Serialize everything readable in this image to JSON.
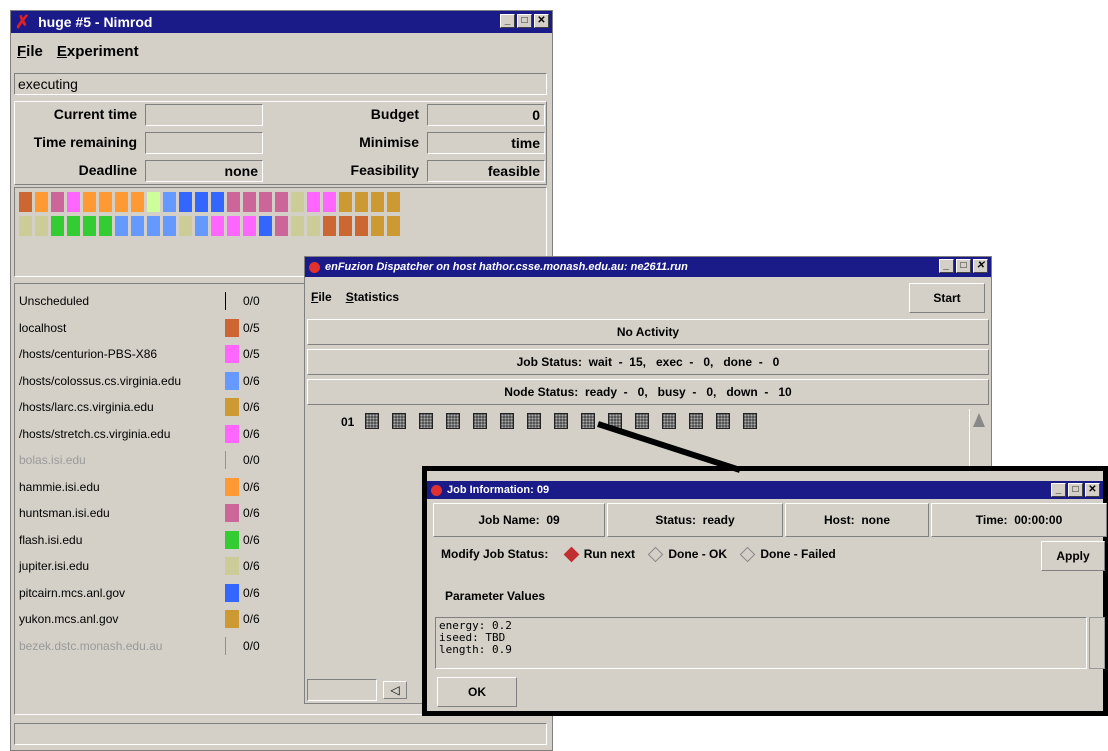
{
  "nimrod": {
    "title": "huge #5 - Nimrod",
    "menu": [
      "File",
      "Experiment"
    ],
    "status": "executing",
    "labels": {
      "current_time": "Current time",
      "time_remaining": "Time remaining",
      "deadline": "Deadline",
      "budget": "Budget",
      "minimise": "Minimise",
      "feasibility": "Feasibility"
    },
    "values": {
      "current_time": "",
      "time_remaining": "",
      "deadline": "none",
      "budget": "0",
      "minimise": "time",
      "feasibility": "feasible"
    },
    "job_grid_colors": [
      [
        "#cc6633",
        "#ff9933",
        "#cc6699",
        "#ff66ff",
        "#ff9933",
        "#ff9933",
        "#ff9933",
        "#ff9933",
        "#ccff99",
        "#6699ff",
        "#3366ff",
        "#3366ff",
        "#3366ff",
        "#cc6699",
        "#cc6699",
        "#cc6699",
        "#cc6699",
        "#cccc99",
        "#ff66ff",
        "#ff66ff",
        "#cc9933",
        "#cc9933",
        "#cc9933",
        "#cc9933"
      ],
      [
        "#cccc99",
        "#cccc99",
        "#33cc33",
        "#33cc33",
        "#33cc33",
        "#33cc33",
        "#6699ff",
        "#6699ff",
        "#6699ff",
        "#6699ff",
        "#cccc99",
        "#6699ff",
        "#ff66ff",
        "#ff66ff",
        "#ff66ff",
        "#3366ff",
        "#cc6699",
        "#cccc99",
        "#cccc99",
        "#cc6633",
        "#cc6633",
        "#cc6633",
        "#cc9933",
        "#cc9933"
      ]
    ],
    "hosts": [
      {
        "name": "Unscheduled",
        "count": "0/0",
        "color": "#000000",
        "active": true,
        "bar": false
      },
      {
        "name": "localhost",
        "count": "0/5",
        "color": "#cc6633",
        "active": true,
        "bar": true
      },
      {
        "name": "/hosts/centurion-PBS-X86",
        "count": "0/5",
        "color": "#ff66ff",
        "active": true,
        "bar": true
      },
      {
        "name": "/hosts/colossus.cs.virginia.edu",
        "count": "0/6",
        "color": "#6699ff",
        "active": true,
        "bar": true
      },
      {
        "name": "/hosts/larc.cs.virginia.edu",
        "count": "0/6",
        "color": "#cc9933",
        "active": true,
        "bar": true
      },
      {
        "name": "/hosts/stretch.cs.virginia.edu",
        "count": "0/6",
        "color": "#ff66ff",
        "active": true,
        "bar": true
      },
      {
        "name": "bolas.isi.edu",
        "count": "0/0",
        "color": "#33cc66",
        "active": false,
        "bar": false
      },
      {
        "name": "hammie.isi.edu",
        "count": "0/6",
        "color": "#ff9933",
        "active": true,
        "bar": true
      },
      {
        "name": "huntsman.isi.edu",
        "count": "0/6",
        "color": "#cc6699",
        "active": true,
        "bar": true
      },
      {
        "name": "flash.isi.edu",
        "count": "0/6",
        "color": "#33cc33",
        "active": true,
        "bar": true
      },
      {
        "name": "jupiter.isi.edu",
        "count": "0/6",
        "color": "#cccc99",
        "active": true,
        "bar": true
      },
      {
        "name": "pitcairn.mcs.anl.gov",
        "count": "0/6",
        "color": "#3366ff",
        "active": true,
        "bar": true
      },
      {
        "name": "yukon.mcs.anl.gov",
        "count": "0/6",
        "color": "#cc9933",
        "active": true,
        "bar": true
      },
      {
        "name": "bezek.dstc.monash.edu.au",
        "count": "0/0",
        "color": "#cc66cc",
        "active": false,
        "bar": false
      }
    ]
  },
  "dispatcher": {
    "title": "enFuzion Dispatcher on host hathor.csse.monash.edu.au: ne2611.run",
    "menu": [
      "File",
      "Statistics"
    ],
    "start_label": "Start",
    "activity": "No Activity",
    "job_status": "Job Status:  wait  -  15,   exec  -   0,   done  -   0",
    "node_status": "Node Status:  ready  -   0,   busy  -   0,   down  -   10",
    "row_label": "01"
  },
  "job_info": {
    "title": "Job Information: 09",
    "job_name": "Job Name:  09",
    "status": "Status:  ready",
    "host": "Host:  none",
    "time": "Time:  00:00:00",
    "modify_label": "Modify Job Status:",
    "options": [
      "Run next",
      "Done - OK",
      "Done - Failed"
    ],
    "selected_option": "Run next",
    "apply_label": "Apply",
    "param_header": "Parameter Values",
    "params": [
      "energy: 0.2",
      "iseed: TBD",
      "length: 0.9"
    ],
    "ok_label": "OK"
  }
}
